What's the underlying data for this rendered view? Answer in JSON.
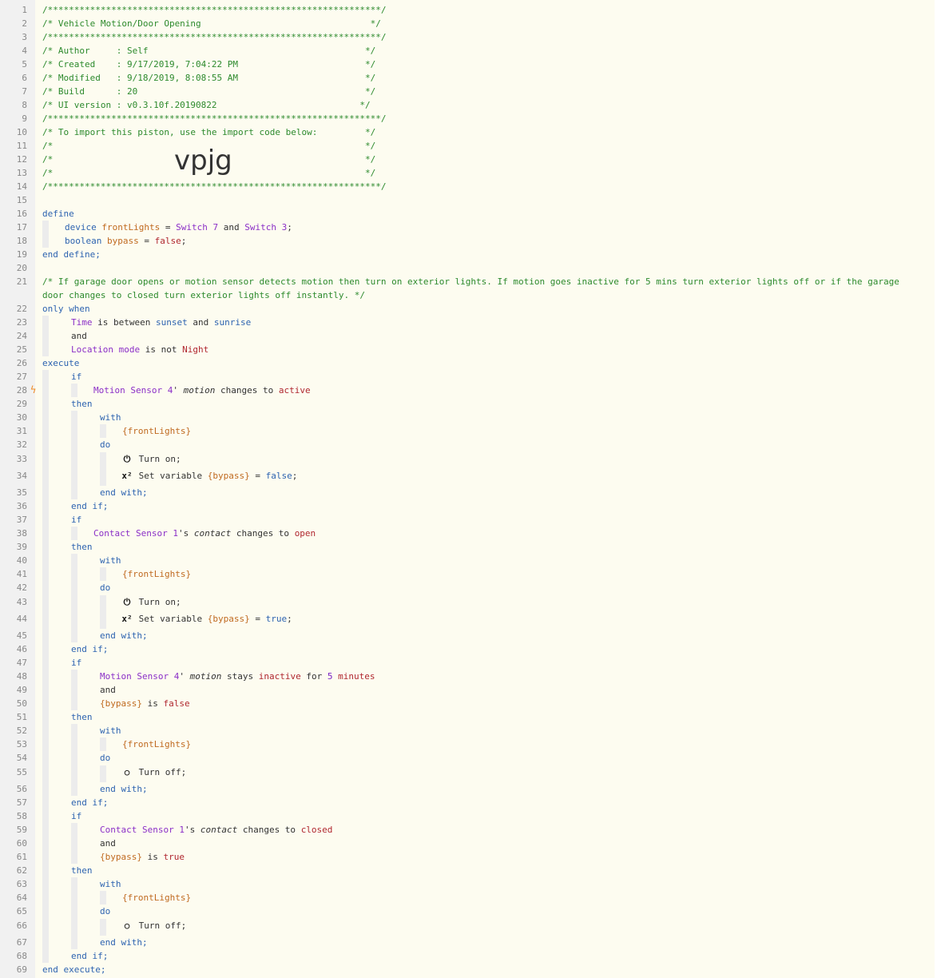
{
  "header": {
    "border": "/***************************************************************/",
    "title": "/* Vehicle Motion/Door Opening                                */",
    "author": "/* Author     : Self                                         */",
    "created": "/* Created    : 9/17/2019, 7:04:22 PM                        */",
    "modified": "/* Modified   : 9/18/2019, 8:08:55 AM                        */",
    "build": "/* Build      : 20                                           */",
    "ui_version": "/* UI version : v0.3.10f.20190822                           */",
    "import_line": "/* To import this piston, use the import code below:         */",
    "blank_line": "/*                                                           */",
    "import_code": "vpjg"
  },
  "code": {
    "define": "define",
    "device_kw": "device",
    "front_lights": "frontLights",
    "eq": "=",
    "switch7": "Switch 7",
    "and": "and",
    "switch3": "Switch 3",
    "semi": ";",
    "boolean_kw": "boolean",
    "bypass": "bypass",
    "false": "false",
    "true": "true",
    "end_define": "end define;",
    "comment": "/* If garage door opens or motion sensor detects motion then turn on exterior lights. If motion goes inactive for 5 mins turn exterior lights off or if the garage door changes to closed turn exterior lights off instantly. */",
    "only_when": "only when",
    "time": "Time",
    "is_between": "is between",
    "sunset": "sunset",
    "sunrise": "sunrise",
    "location_mode": "Location mode",
    "is_not": "is not",
    "night": "Night",
    "execute": "execute",
    "if": "if",
    "motion_sensor": "Motion Sensor 4",
    "apos": "'",
    "motion": "motion",
    "changes_to": "changes to",
    "active": "active",
    "then": "then",
    "with": "with",
    "front_lights_ref": "{frontLights}",
    "do": "do",
    "turn_on": "Turn on;",
    "turn_off": "Turn off;",
    "set_variable": "Set variable",
    "bypass_ref": "{bypass}",
    "end_with": "end with;",
    "end_if": "end if;",
    "contact_sensor": "Contact Sensor 1",
    "s": "'s",
    "contact": "contact",
    "open": "open",
    "stays": "stays",
    "inactive": "inactive",
    "for": "for",
    "five": "5",
    "minutes": "minutes",
    "is": "is",
    "closed": "closed",
    "end_execute": "end execute;",
    "power_icon": "⏻",
    "off_icon": "○",
    "x2_icon": "x²"
  },
  "colors": {
    "comment": "#2d8a2d",
    "keyword": "#2d63b0",
    "device": "#8b2fc7",
    "variable": "#c06a20",
    "value": "#b0272f",
    "trigger_bolt": "#f08a24"
  }
}
